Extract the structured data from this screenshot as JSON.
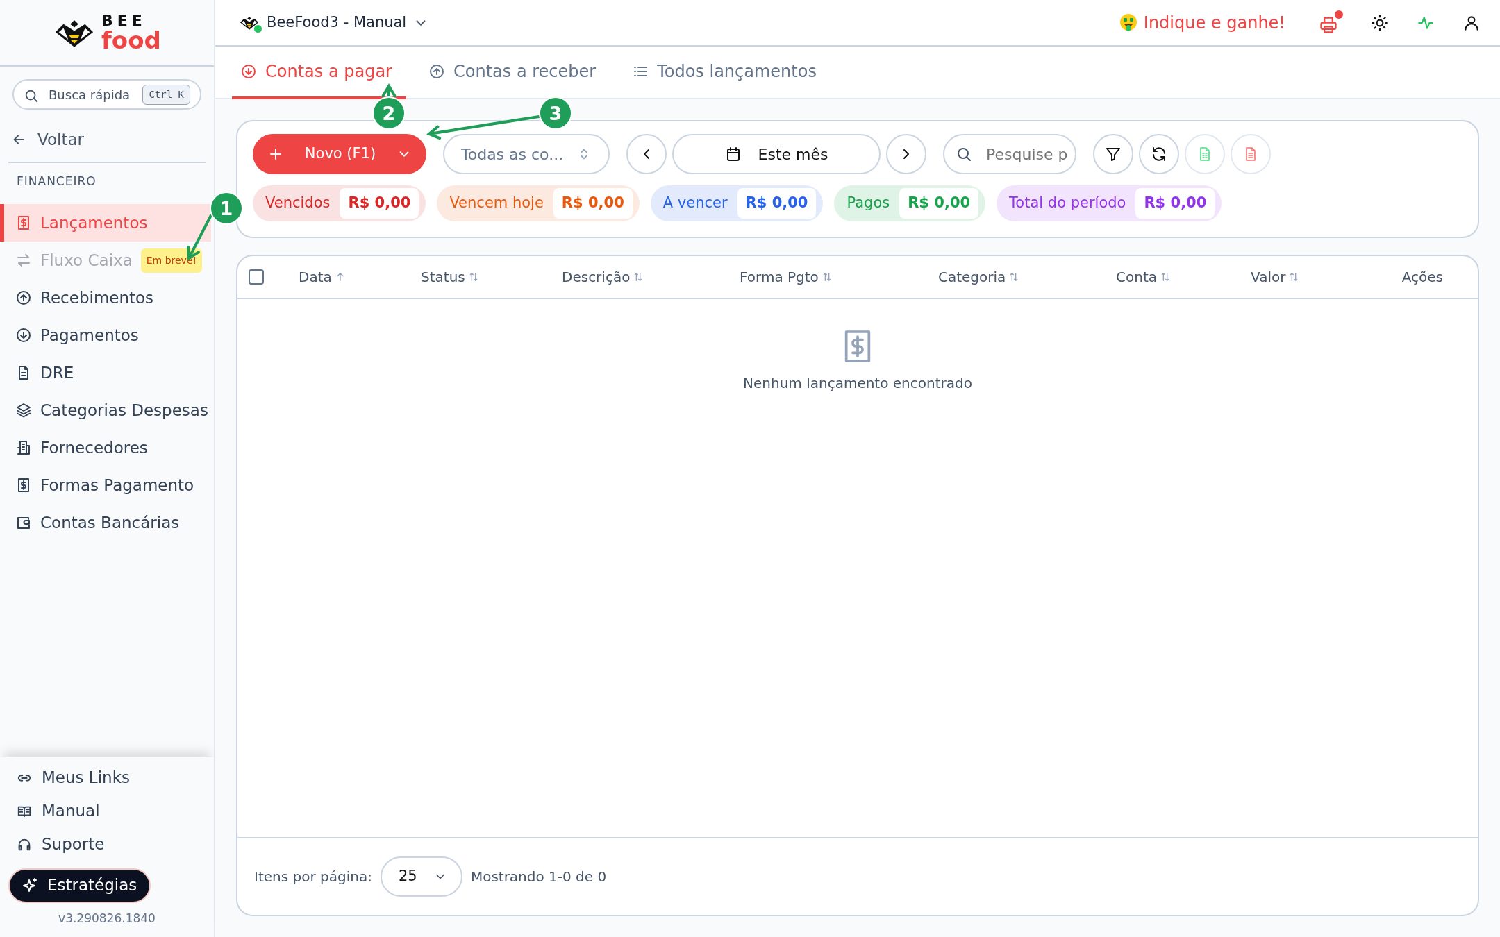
{
  "brand": {
    "line1": "BEE",
    "line2": "food"
  },
  "quick_search": {
    "placeholder": "Busca rápida",
    "shortcut": "Ctrl K"
  },
  "back": "Voltar",
  "section": "FINANCEIRO",
  "nav": [
    {
      "label": "Lançamentos",
      "selected": true,
      "disabled": false
    },
    {
      "label": "Fluxo Caixa",
      "selected": false,
      "disabled": true,
      "badge": "Em breve!"
    },
    {
      "label": "Recebimentos",
      "selected": false,
      "disabled": false
    },
    {
      "label": "Pagamentos",
      "selected": false,
      "disabled": false
    },
    {
      "label": "DRE",
      "selected": false,
      "disabled": false
    },
    {
      "label": "Categorias Despesas",
      "selected": false,
      "disabled": false
    },
    {
      "label": "Fornecedores",
      "selected": false,
      "disabled": false
    },
    {
      "label": "Formas Pagamento",
      "selected": false,
      "disabled": false
    },
    {
      "label": "Contas Bancárias",
      "selected": false,
      "disabled": false
    }
  ],
  "bottom_links": [
    {
      "label": "Meus Links"
    },
    {
      "label": "Manual"
    },
    {
      "label": "Suporte"
    }
  ],
  "strategies_button": "Estratégias",
  "version": "v3.290826.1840",
  "header": {
    "store": "BeeFood3 - Manual",
    "store_online": true,
    "referral": "Indique e ganhe!",
    "printer_alert": true
  },
  "tabs": [
    {
      "label": "Contas a pagar",
      "selected": true
    },
    {
      "label": "Contas a receber",
      "selected": false
    },
    {
      "label": "Todos lançamentos",
      "selected": false
    }
  ],
  "toolbar": {
    "new_button": "Novo (F1)",
    "account_select": "Todas as co...",
    "period": "Este mês",
    "search_placeholder": "Pesquise p"
  },
  "summary": [
    {
      "label": "Vencidos",
      "value": "R$ 0,00",
      "color": "#dc2626"
    },
    {
      "label": "Vencem hoje",
      "value": "R$ 0,00",
      "color": "#ea580c"
    },
    {
      "label": "A vencer",
      "value": "R$ 0,00",
      "color": "#2563eb"
    },
    {
      "label": "Pagos",
      "value": "R$ 0,00",
      "color": "#16a34a"
    },
    {
      "label": "Total do período",
      "value": "R$ 0,00",
      "color": "#9333ea"
    }
  ],
  "table": {
    "columns": [
      {
        "label": "Data"
      },
      {
        "label": "Status"
      },
      {
        "label": "Descrição"
      },
      {
        "label": "Forma Pgto"
      },
      {
        "label": "Categoria"
      },
      {
        "label": "Conta"
      },
      {
        "label": "Valor"
      },
      {
        "label": "Ações"
      }
    ],
    "select_all_checked": false,
    "empty_message": "Nenhum lançamento encontrado"
  },
  "pagination": {
    "label": "Itens por página:",
    "page_size": "25",
    "range": "Mostrando 1-0 de 0"
  },
  "annotations": [
    {
      "label": "1"
    },
    {
      "label": "2"
    },
    {
      "label": "3"
    }
  ]
}
